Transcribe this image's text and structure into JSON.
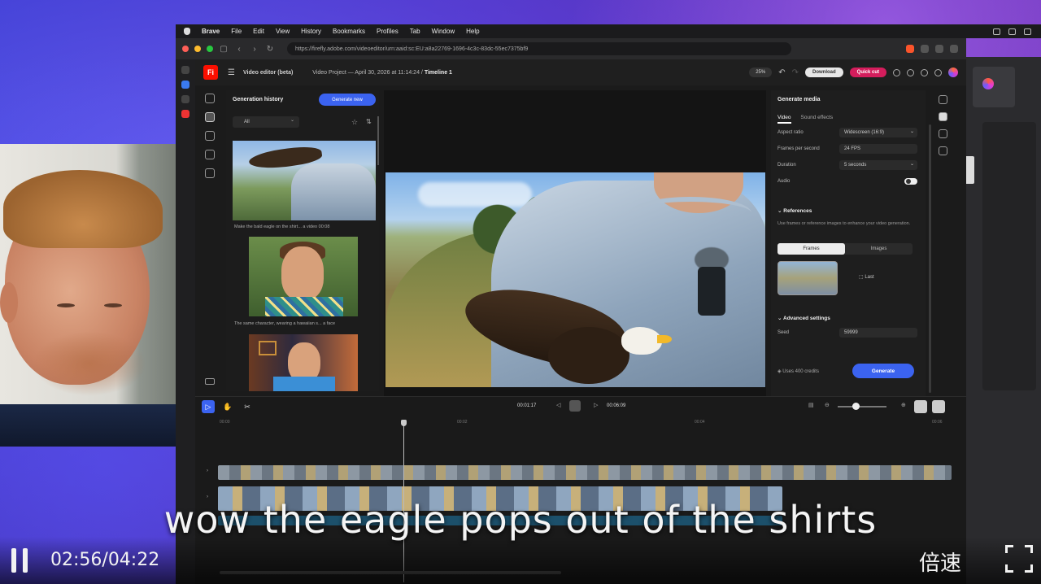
{
  "menubar": {
    "items": [
      "Brave",
      "File",
      "Edit",
      "View",
      "History",
      "Bookmarks",
      "Profiles",
      "Tab",
      "Window",
      "Help"
    ]
  },
  "browser": {
    "url": "https://firefly.adobe.com/videoeditor/urn:aaid:sc:EU:a8a22769-1696-4c3c-83dc-55ec7375bf9"
  },
  "app": {
    "logo": "Fi",
    "title": "Video editor (beta)",
    "project": "Video Project — April 30, 2026 at 11:14:24",
    "timeline_name": "Timeline 1",
    "zoom": "25%",
    "download_label": "Download",
    "quick_cut_label": "Quick cut"
  },
  "history": {
    "title": "Generation history",
    "generate_label": "Generate new",
    "filter": "All",
    "captions": [
      "Make the bald eagle on the shirt... a video   00:08",
      "The same character, wearing a hawaiian s... a face"
    ]
  },
  "settings": {
    "title": "Generate media",
    "tabs": [
      "Video",
      "Sound effects"
    ],
    "aspect_ratio_label": "Aspect ratio",
    "aspect_ratio_value": "Widescreen (16:9)",
    "fps_label": "Frames per second",
    "fps_value": "24 FPS",
    "duration_label": "Duration",
    "duration_value": "5 seconds",
    "audio_label": "Audio",
    "references_title": "References",
    "references_desc": "Use frames or reference images to enhance your video generation.",
    "seg_frames": "Frames",
    "seg_images": "Images",
    "last_label": "Last",
    "advanced_title": "Advanced settings",
    "seed_label": "Seed",
    "seed_value": "59999",
    "credits": "Uses 400 credits",
    "generate_label": "Generate"
  },
  "timeline": {
    "current_time": "00:01:17",
    "total_time": "00:06:09",
    "ruler": [
      "00:00",
      "00:02",
      "00:04",
      "00:06"
    ]
  },
  "overlay": {
    "subtitle": "wow the eagle pops out of the shirts",
    "player_time": "02:56/04:22",
    "speed_label": "倍速"
  },
  "colors": {
    "accent": "#3b63f0",
    "quick_cut": "#d41d5c",
    "firefly_red": "#fa0f00"
  }
}
